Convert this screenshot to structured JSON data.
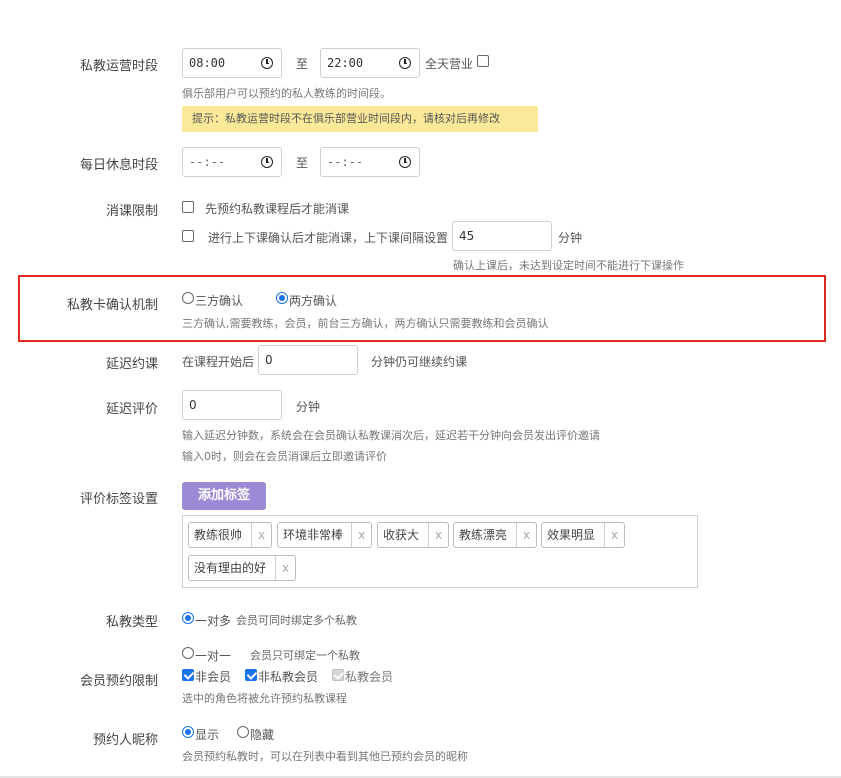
{
  "operating_hours": {
    "label": "私教运营时段",
    "start": "08:00",
    "separator": "至",
    "end": "22:00",
    "all_day_label": "全天营业",
    "hint": "俱乐部用户可以预约的私人教练的时间段。",
    "warning": "提示：私教运营时段不在俱乐部营业时间段内，请核对后再修改"
  },
  "rest_hours": {
    "label": "每日休息时段",
    "start": "--:--",
    "separator": "至",
    "end": "--:--"
  },
  "consume_limit": {
    "label": "消课限制",
    "option1": "先预约私教课程后才能消课",
    "option2": "进行上下课确认后才能消课，上下课间隔设置",
    "interval_value": "45",
    "interval_unit": "分钟",
    "hint": "确认上课后，未达到设定时间不能进行下课操作"
  },
  "confirm_mechanism": {
    "label": "私教卡确认机制",
    "option_three": "三方确认",
    "option_two": "两方确认",
    "hint": "三方确认,需要教练，会员，前台三方确认，两方确认只需要教练和会员确认"
  },
  "delay_booking": {
    "label": "延迟约课",
    "prefix": "在课程开始后",
    "value": "0",
    "suffix": "分钟仍可继续约课"
  },
  "delay_review": {
    "label": "延迟评价",
    "value": "0",
    "unit": "分钟",
    "hint1": "输入延迟分钟数，系统会在会员确认私教课消次后，延迟若干分钟向会员发出评价邀请",
    "hint2": "输入0时，则会在会员消课后立即邀请评价"
  },
  "review_tags": {
    "label": "评价标签设置",
    "add_button": "添加标签",
    "remove_glyph": "x",
    "tags": [
      "教练很帅",
      "环境非常棒",
      "收获大",
      "教练漂亮",
      "效果明显",
      "没有理由的好"
    ]
  },
  "coach_type": {
    "label": "私教类型",
    "option_many": "一对多",
    "option_many_desc": "会员可同时绑定多个私教",
    "option_one": "一对一",
    "option_one_desc": "会员只可绑定一个私教"
  },
  "booking_limit": {
    "label": "会员预约限制",
    "opt_non_member": "非会员",
    "opt_non_coach_member": "非私教会员",
    "opt_coach_member": "私教会员",
    "hint": "选中的角色将被允许预约私教课程"
  },
  "nickname": {
    "label": "预约人昵称",
    "opt_show": "显示",
    "opt_hide": "隐藏",
    "hint": "会员预约私教时，可以在列表中看到其他已预约会员的昵称"
  },
  "colors": {
    "accent": "#1a73e8",
    "highlight_border": "#e02a20",
    "warning_bg": "#fbe99a",
    "button_bg": "#9c8ad6"
  }
}
